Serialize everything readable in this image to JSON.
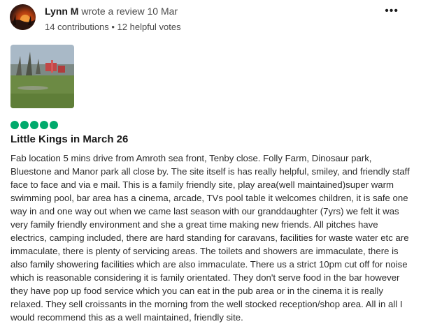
{
  "review": {
    "author": {
      "name": "Lynn M",
      "action": "wrote a review 10 Mar",
      "stats": "14 contributions • 12 helpful votes"
    },
    "more_icon": "more-options-icon",
    "photo_alt": "campsite-photo",
    "rating": {
      "value": 5,
      "max": 5,
      "color": "#00aa6c"
    },
    "title": "Little Kings in March 26",
    "text": "Fab location 5 mins drive from Amroth sea front, Tenby close. Folly Farm, Dinosaur park, Bluestone and Manor park all close by. The site itself is has really helpful, smiley, and friendly staff face to face and via e mail. This is a family friendly site, play area(well maintained)super warm swimming pool, bar area has a cinema, arcade, TVs pool table it welcomes children, it is safe one way in and one way out when we came last season with our granddaughter (7yrs) we felt it was very family friendly environment and she a great time making new friends. All pitches have electrics, camping included, there are hard standing for caravans, facilities for waste water etc are immaculate, there is plenty of servicing areas. The toilets and showers are immaculate, there is also family showering facilities which are also immaculate. There us a strict 10pm cut off for noise which is reasonable considering it is family orientated. They don't serve food in the bar however they have pop up food service which you can eat in the pub area or in the cinema it is really relaxed. They sell croissants in the morning from the well stocked reception/shop area. All in all I would recommend this as a well maintained, friendly site."
  }
}
